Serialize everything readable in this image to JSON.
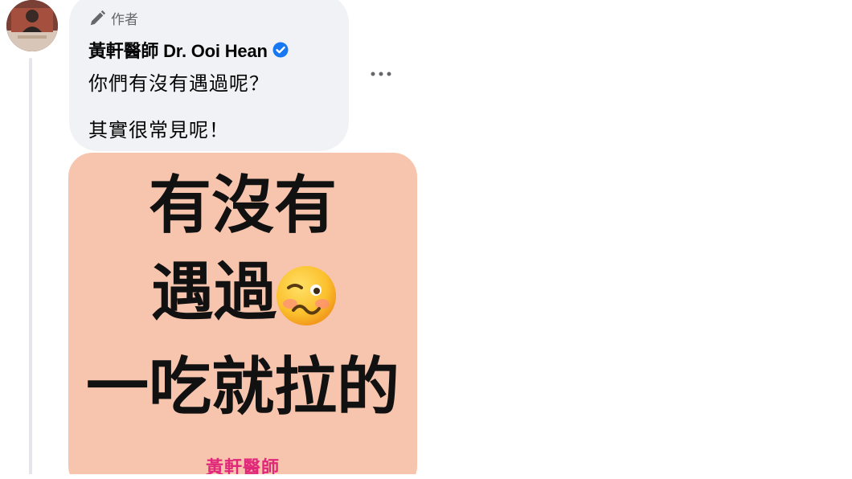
{
  "comment": {
    "author_badge": "作者",
    "author_name": "黃軒醫師 Dr. Ooi Hean",
    "lines": [
      "你們有沒有遇過呢？",
      "其實很常見呢！"
    ],
    "more_label": "···"
  },
  "image": {
    "lines": [
      "有沒有",
      "遇過",
      "一吃就拉的"
    ],
    "emoji": "woozy-face",
    "watermark": "黃軒醫師",
    "background": "#f7c4ad",
    "watermark_color": "#e0277a"
  },
  "colors": {
    "bubble": "#f0f2f5",
    "verified": "#1877f2",
    "muted_text": "#65676b"
  }
}
